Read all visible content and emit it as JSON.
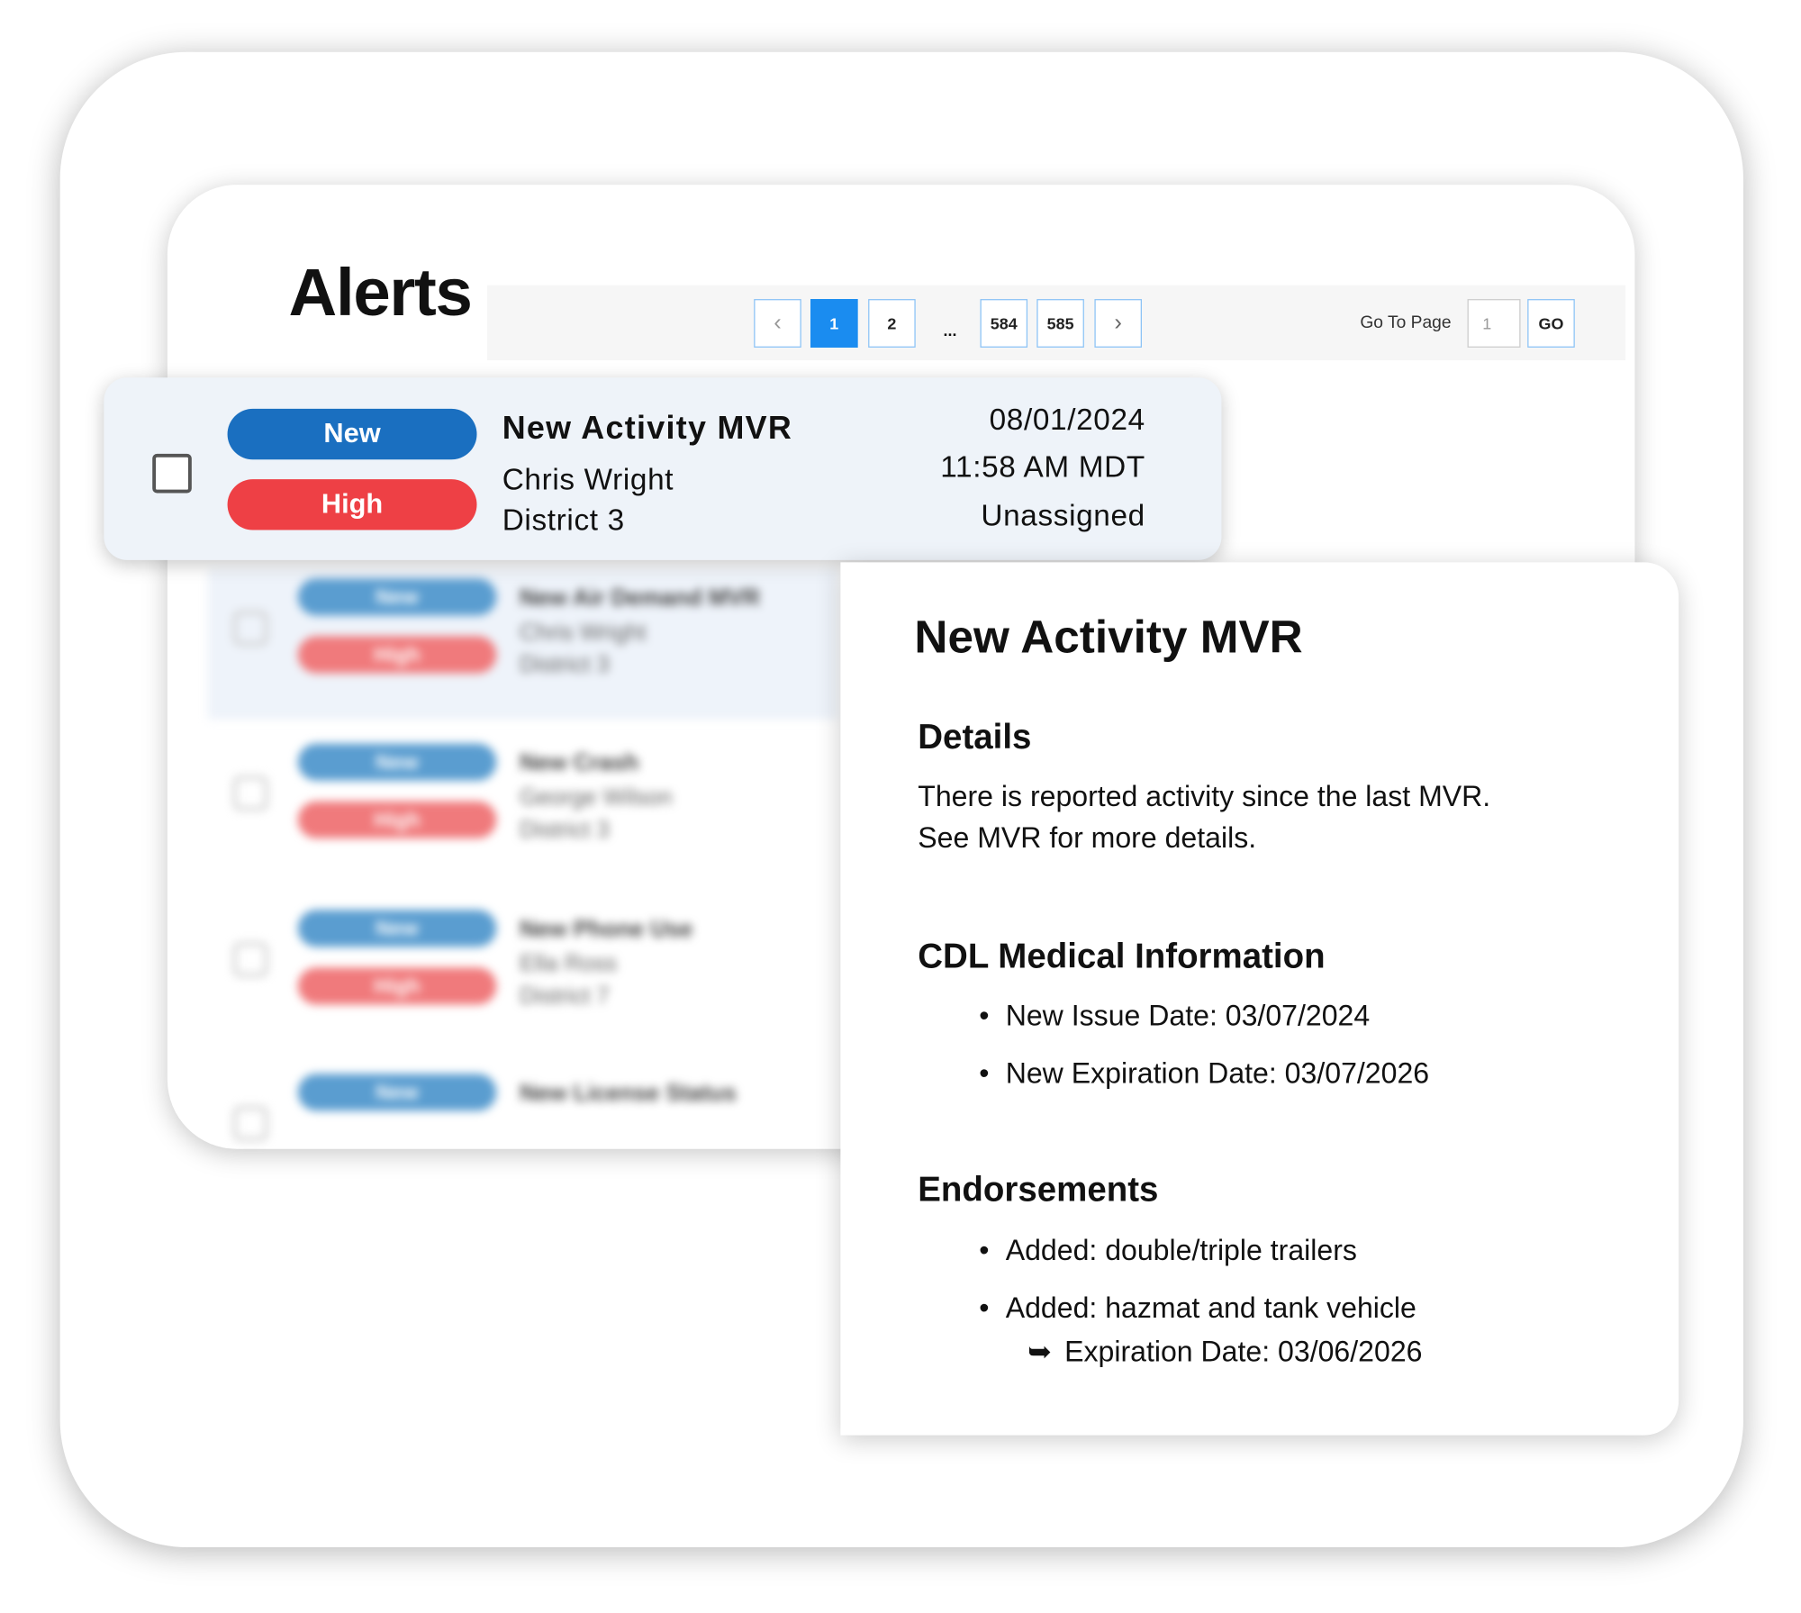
{
  "header": {
    "title": "Alerts"
  },
  "pagination": {
    "prev_icon": "chevron-left-icon",
    "next_icon": "chevron-right-icon",
    "pages": [
      "1",
      "2",
      "584",
      "585"
    ],
    "current": "1",
    "ellipsis": "...",
    "goto_label": "Go To Page",
    "goto_value": "1",
    "go_label": "GO",
    "accent": "#1a8cf0"
  },
  "selected_alert": {
    "status": "New",
    "priority": "High",
    "title": "New Activity MVR",
    "driver": "Chris Wright",
    "district": "District 3",
    "date": "08/01/2024",
    "time": "11:58 AM MDT",
    "assignee": "Unassigned",
    "status_color": "#1a6fc0",
    "priority_color": "#ee4045"
  },
  "blurred_alerts": [
    {
      "status": "New",
      "priority": "High",
      "title": "New Air Demand MVR",
      "driver": "Chris Wright",
      "district": "District 3"
    },
    {
      "status": "New",
      "priority": "High",
      "title": "New Crash",
      "driver": "George Wilson",
      "district": "District 3"
    },
    {
      "status": "New",
      "priority": "High",
      "title": "New Phone Use",
      "driver": "Ella Ross",
      "district": "District 7"
    },
    {
      "status": "New",
      "title": "New License Status"
    }
  ],
  "detail": {
    "title": "New Activity MVR",
    "details_heading": "Details",
    "details_lines": [
      "There is reported activity since the last MVR.",
      "See MVR for more details."
    ],
    "cdl_heading": "CDL Medical Information",
    "cdl_items": [
      "New Issue Date: 03/07/2024",
      "New Expiration Date: 03/07/2026"
    ],
    "endorsements_heading": "Endorsements",
    "endorsement_items": [
      "Added: double/triple trailers",
      "Added: hazmat and tank vehicle"
    ],
    "endorsement_sub": "Expiration Date: 03/06/2026",
    "bullet": "•",
    "arrow": "➥"
  }
}
